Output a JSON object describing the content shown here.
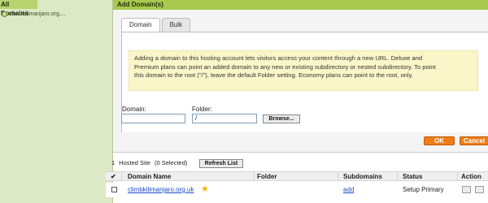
{
  "left_panel": {
    "root_label": "All Domains",
    "items": [
      {
        "label": "climbkilimanjaro.org...."
      }
    ]
  },
  "dialog": {
    "title": "Add Domain(s)",
    "tabs": [
      {
        "label": "Domain",
        "active": true
      },
      {
        "label": "Bulk",
        "active": false
      }
    ],
    "info_lines": [
      "Adding a domain to this hosting account lets visitors access your content through a new URL. Deluxe and",
      "Premium plans can point an added domain to any new or existing subdirectory or nested subdirectory. To point",
      "this domain to the root (\"/\"), leave the default Folder setting. Economy plans can point to the root, only."
    ],
    "domain_label": "Domain:",
    "domain_value": "",
    "folder_label": "Folder:",
    "folder_value": "/",
    "browse_label": "Browse...",
    "ok_label": "OK",
    "cancel_label": "Cancel"
  },
  "list": {
    "hosted_count": "1",
    "hosted_label": "Hosted Site",
    "selected_text": "(0 Selected)",
    "refresh_label": "Refresh List",
    "columns": {
      "check": "✔",
      "domain": "Domain Name",
      "folder": "Folder",
      "subdomains": "Subdomains",
      "status": "Status",
      "action": "Action"
    },
    "rows": [
      {
        "domain": "climbkilimanjaro.org.uk",
        "folder": "",
        "subdomains": "add",
        "status": "Setup Primary"
      }
    ]
  },
  "colors": {
    "header_green": "#a9c84e",
    "panel_green": "#dde8c6",
    "accent_orange": "#ef7d19",
    "info_yellow": "#fbf6c9",
    "link_blue": "#1c4cc7"
  }
}
